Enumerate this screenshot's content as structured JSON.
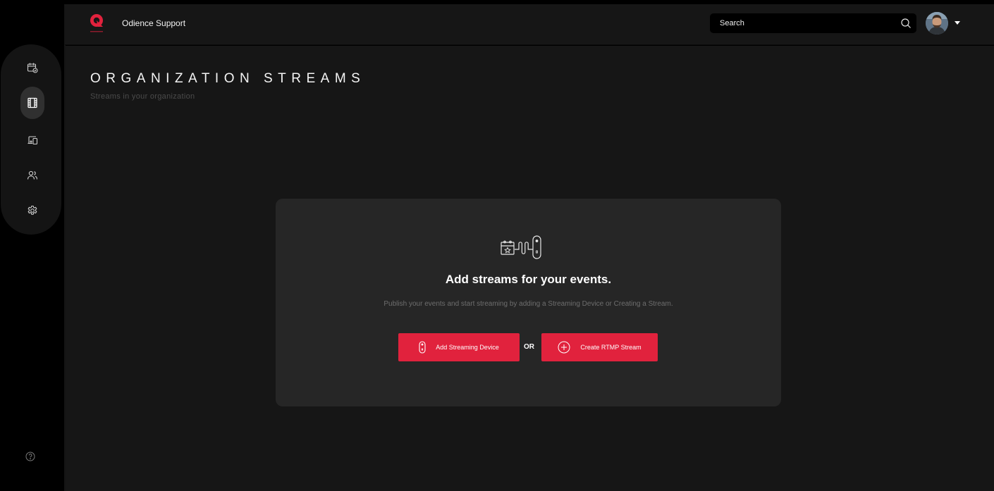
{
  "header": {
    "brand_name": "Odience Support",
    "search_placeholder": "Search",
    "accent_color": "#e1223d"
  },
  "sidebar": {
    "items": [
      {
        "name": "calendar-check-icon",
        "active": false
      },
      {
        "name": "film-icon",
        "active": true
      },
      {
        "name": "devices-icon",
        "active": false
      },
      {
        "name": "users-icon",
        "active": false
      },
      {
        "name": "settings-icon",
        "active": false
      }
    ],
    "footer_icon": "help-icon"
  },
  "page": {
    "title": "ORGANIZATION STREAMS",
    "subtitle": "Streams in your organization"
  },
  "empty_state": {
    "title": "Add streams for your events.",
    "description": "Publish your events and start streaming by adding a Streaming Device or Creating a Stream.",
    "add_device_label": "Add Streaming Device",
    "or_label": "OR",
    "create_rtmp_label": "Create RTMP Stream"
  }
}
